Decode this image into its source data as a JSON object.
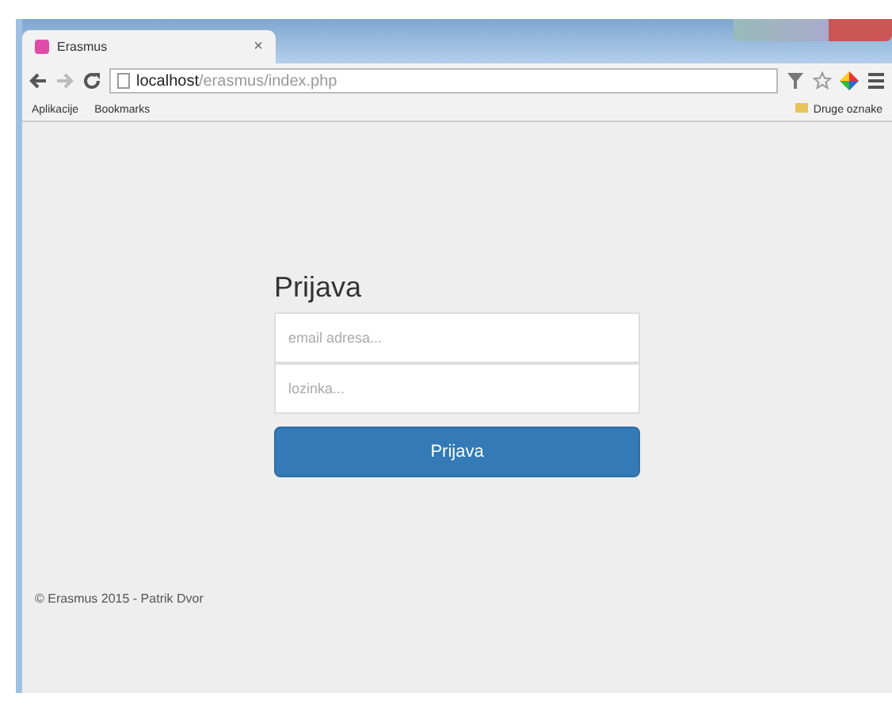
{
  "browser": {
    "tab": {
      "title": "Erasmus",
      "close": "×"
    },
    "url_host": "localhost",
    "url_path": "/erasmus/index.php",
    "bookmarks": [
      "Aplikacije",
      "Bookmarks"
    ],
    "other_bookmarks": "Druge oznake"
  },
  "login": {
    "heading": "Prijava",
    "fields": [
      {
        "placeholder": "email adresa..."
      },
      {
        "placeholder": "lozinka..."
      }
    ],
    "button": "Prijava"
  },
  "footer": "© Erasmus 2015 - Patrik Dvor"
}
